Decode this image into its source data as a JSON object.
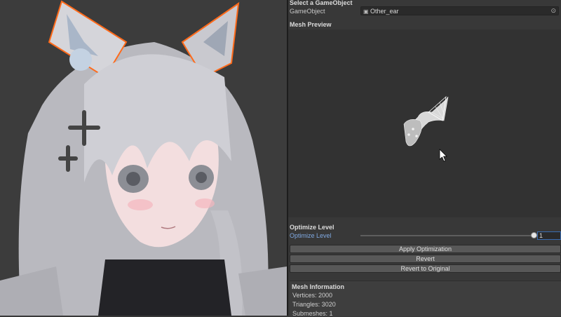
{
  "scene": {
    "description_icon": "avatar-character-render"
  },
  "inspector": {
    "select_title": "Select a GameObject",
    "gameobject_label": "GameObject",
    "gameobject_value": "Other_ear",
    "gameobject_icon": "cube-icon",
    "picker_icon": "target-picker-icon",
    "mesh_preview_title": "Mesh Preview",
    "optimize_title": "Optimize Level",
    "optimize_label": "Optimize Level",
    "optimize_value": "1",
    "optimize_fraction": 0.97,
    "buttons": {
      "apply": "Apply Optimization",
      "revert": "Revert",
      "revert_original": "Revert to Original"
    },
    "mesh_info": {
      "title": "Mesh Information",
      "vertices": "Vertices: 2000",
      "triangles": "Triangles: 3020",
      "submeshes": "Submeshes: 1"
    }
  },
  "colors": {
    "accent": "#3a6cb0",
    "selection_outline": "#ff6a1a",
    "panel": "#383838"
  }
}
